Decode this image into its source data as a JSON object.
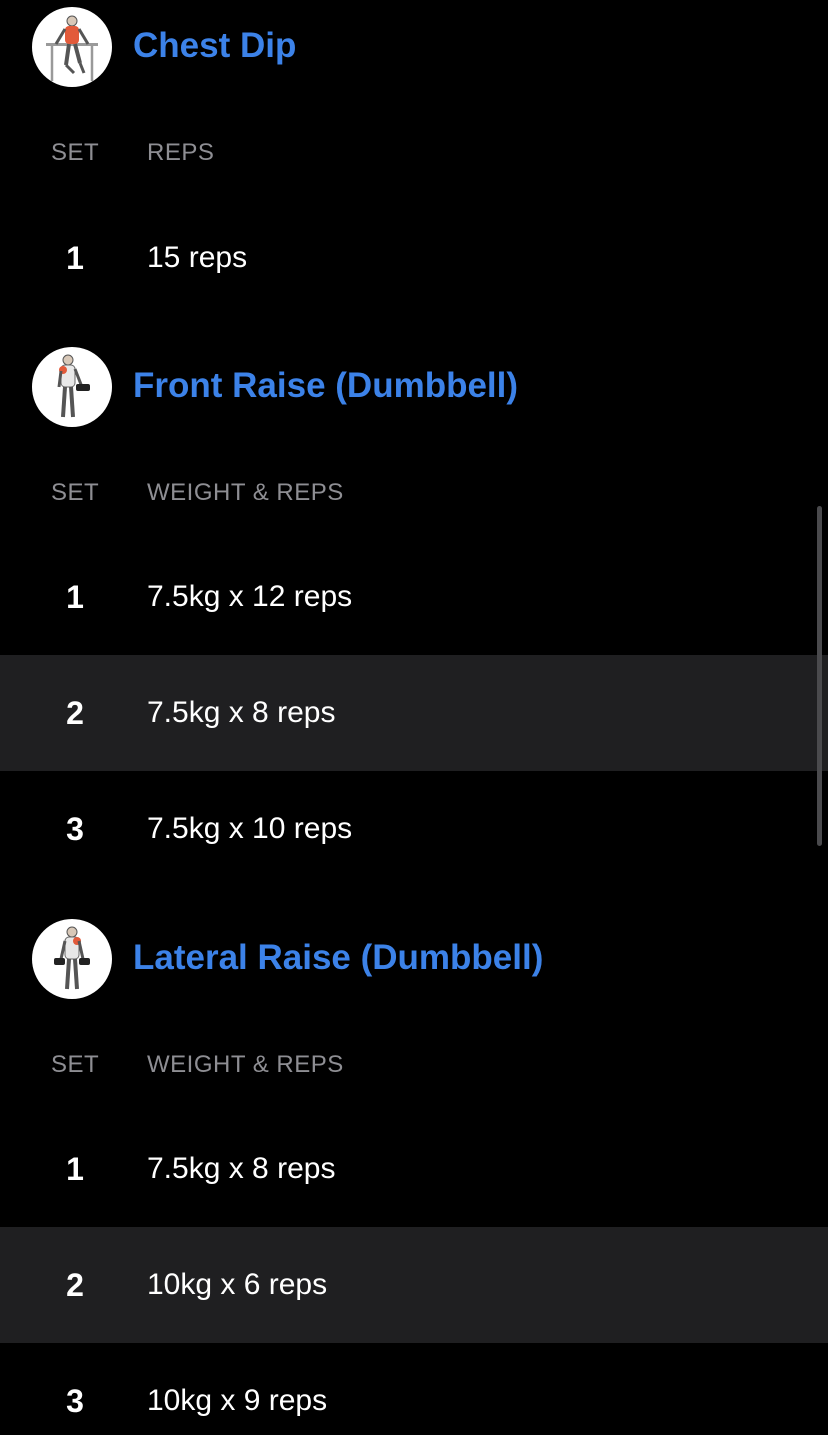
{
  "theme": {
    "background": "#000000",
    "accent": "#3c82e8",
    "header_text": "#8e8e93",
    "row_text": "#ffffff",
    "alt_row_bg": "#1f1f21"
  },
  "columns": {
    "set": "SET",
    "reps": "REPS",
    "weight_reps": "WEIGHT & REPS"
  },
  "exercises": [
    {
      "name": "Chest Dip",
      "icon": "chest-dip-icon",
      "column_label": "REPS",
      "sets": [
        {
          "set": "1",
          "value": "15 reps"
        }
      ]
    },
    {
      "name": "Front Raise (Dumbbell)",
      "icon": "front-raise-icon",
      "column_label": "WEIGHT & REPS",
      "sets": [
        {
          "set": "1",
          "value": "7.5kg x 12 reps"
        },
        {
          "set": "2",
          "value": "7.5kg x 8 reps"
        },
        {
          "set": "3",
          "value": "7.5kg x 10 reps"
        }
      ]
    },
    {
      "name": "Lateral Raise (Dumbbell)",
      "icon": "lateral-raise-icon",
      "column_label": "WEIGHT & REPS",
      "sets": [
        {
          "set": "1",
          "value": "7.5kg x 8 reps"
        },
        {
          "set": "2",
          "value": "10kg x 6 reps"
        },
        {
          "set": "3",
          "value": "10kg x 9 reps"
        }
      ]
    }
  ]
}
